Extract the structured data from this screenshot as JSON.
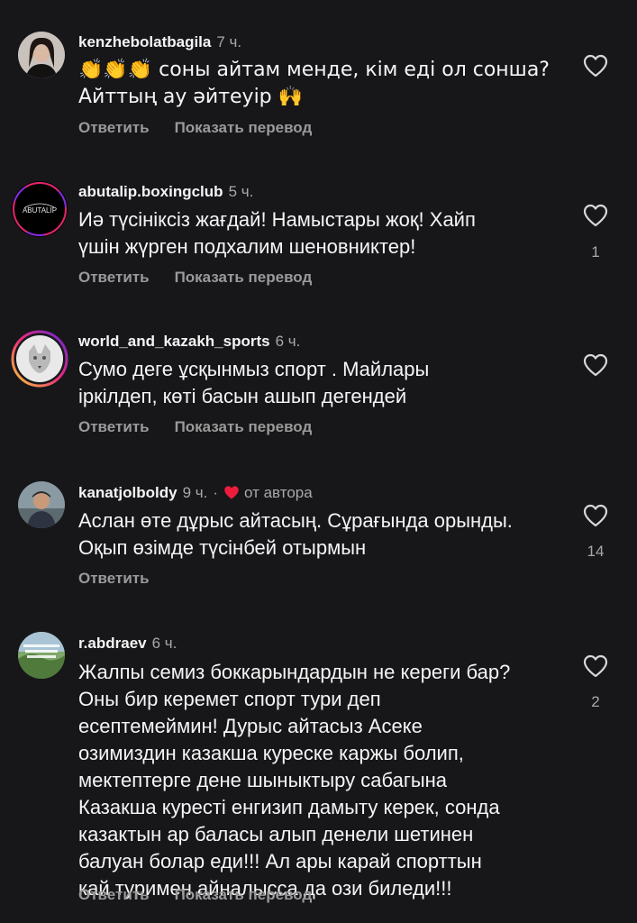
{
  "colors": {
    "background": "#17171a",
    "text": "#f5f5f5",
    "muted": "#a8a8a8",
    "action": "#9a9a9a",
    "heart_red": "#ed1c3c"
  },
  "comments": [
    {
      "username": "kenzhebolatbagila",
      "time": "7 ч.",
      "lines": [
        "👏👏👏 соны айтам менде,  кім еді ол сонша?",
        "Айттың ау әйтеуір 🙌"
      ],
      "reply": "Ответить",
      "translate": "Показать перевод",
      "likes": ""
    },
    {
      "username": "abutalip.boxingclub",
      "time": "5 ч.",
      "lines": [
        "Иә түсініксіз жағдай! Намыстары жоқ! Хайп",
        "үшін жүрген подхалим шеновниктер!"
      ],
      "reply": "Ответить",
      "translate": "Показать перевод",
      "likes": "1",
      "avatar_text": "ABUTALIP"
    },
    {
      "username": "world_and_kazakh_sports",
      "time": "6 ч.",
      "lines": [
        "Сумо деге ұсқынмыз спорт .  Майлары",
        "іркілдеп, көті басын ашып дегендей"
      ],
      "reply": "Ответить",
      "translate": "Показать перевод",
      "likes": ""
    },
    {
      "username": "kanatjolboldy",
      "time": "9 ч.",
      "author_label": "от автора",
      "lines": [
        "Аслан өте дұрыс айтасың. Сұрағында орынды.",
        "Оқып өзімде түсінбей отырмын"
      ],
      "reply": "Ответить",
      "likes": "14"
    },
    {
      "username": "r.abdraev",
      "time": "6 ч.",
      "lines": [
        "Жалпы семиз боккарындардын не кереги бар?",
        "Оны бир керемет спорт тури деп",
        "есептемеймин! Дурыс айтасыз Асеке",
        "озимиздин казакша куреске каржы болип,",
        "мектептерге дене  шыныктыру сабагына",
        "Казакша куресті енгизип дамыту керек, сонда",
        "казактын ар баласы алып денели шетинен",
        "балуан болар еди!!! Ал ары карай спорттын",
        "кай туримен айналысса да ози биледи!!!"
      ],
      "reply": "Ответить",
      "translate": "Показать перевод",
      "likes": "2"
    }
  ]
}
